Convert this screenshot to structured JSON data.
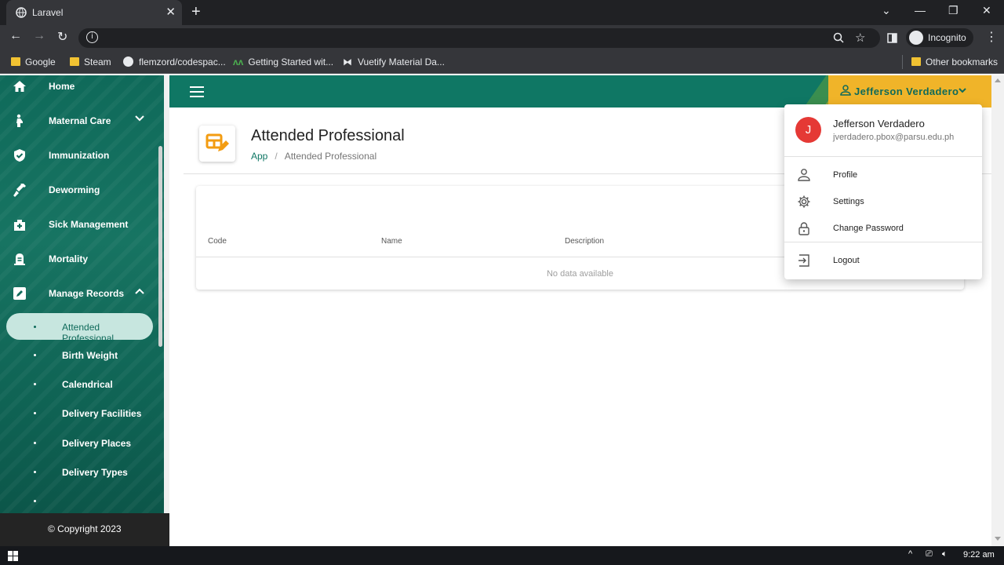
{
  "browser": {
    "tab_title": "Laravel",
    "new_tab": "+",
    "incognito_label": "Incognito",
    "bookmarks": [
      {
        "label": "Google",
        "icon": "folder-icon"
      },
      {
        "label": "Steam",
        "icon": "folder-icon"
      },
      {
        "label": "flemzord/codespac...",
        "icon": "github-icon"
      },
      {
        "label": "Getting Started wit...",
        "icon": "vuetify-m-icon"
      },
      {
        "label": "Vuetify Material Da...",
        "icon": "bowtie-icon"
      }
    ],
    "other_bookmarks": "Other bookmarks"
  },
  "sidebar": {
    "items": [
      {
        "label": "Home",
        "icon": "home-icon"
      },
      {
        "label": "Maternal Care",
        "icon": "pregnant-icon"
      },
      {
        "label": "Immunization",
        "icon": "shield-check-icon"
      },
      {
        "label": "Deworming",
        "icon": "syringe-icon"
      },
      {
        "label": "Sick Management",
        "icon": "medical-bag-icon"
      },
      {
        "label": "Mortality",
        "icon": "gravestone-icon"
      },
      {
        "label": "Manage Records",
        "icon": "pencil-box-icon"
      }
    ],
    "subitems": [
      {
        "label": "Attended Professional",
        "active": true
      },
      {
        "label": "Birth Weight"
      },
      {
        "label": "Calendrical"
      },
      {
        "label": "Delivery Facilities"
      },
      {
        "label": "Delivery Places"
      },
      {
        "label": "Delivery Types"
      }
    ],
    "footer": "© Copyright 2023"
  },
  "appbar": {
    "user_name": "Jefferson Verdadero"
  },
  "page": {
    "title": "Attended Professional",
    "breadcrumb_root": "App",
    "breadcrumb_sep": "/",
    "breadcrumb_current": "Attended Professional"
  },
  "table": {
    "headers": [
      "Code",
      "Name",
      "Description"
    ],
    "empty_text": "No data available"
  },
  "user_menu": {
    "avatar_letter": "J",
    "name": "Jefferson Verdadero",
    "email": "jverdadero.pbox@parsu.edu.ph",
    "items": [
      {
        "label": "Profile",
        "icon": "account-icon"
      },
      {
        "label": "Settings",
        "icon": "gear-icon"
      },
      {
        "label": "Change Password",
        "icon": "lock-icon"
      },
      {
        "label": "Logout",
        "icon": "logout-icon"
      }
    ]
  },
  "taskbar": {
    "time": "9:22 am"
  },
  "colors": {
    "primary": "#0f7764",
    "accent": "#f0b429",
    "avatar": "#e53935"
  }
}
